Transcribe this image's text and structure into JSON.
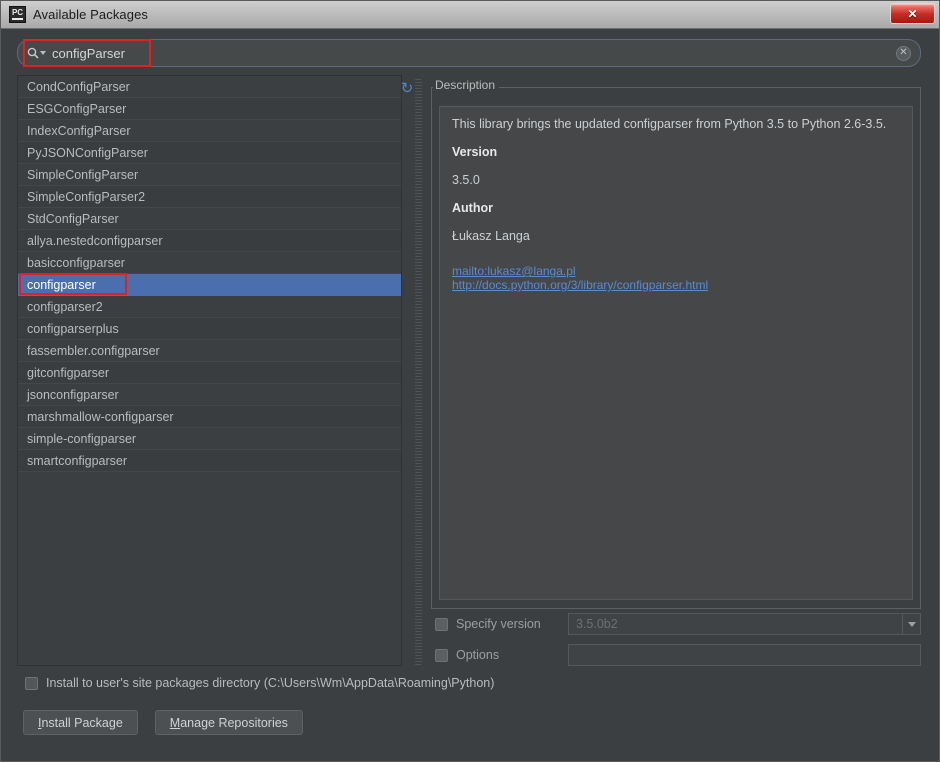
{
  "window": {
    "title": "Available Packages",
    "app_icon": "pycharm-icon",
    "close_label": "✕"
  },
  "search": {
    "value": "configParser",
    "placeholder": "",
    "icon": "search-icon",
    "chevron": "chevron-down-icon",
    "clear_icon": "✕"
  },
  "packages": {
    "refresh_icon": "↻",
    "items": [
      "CondConfigParser",
      "ESGConfigParser",
      "IndexConfigParser",
      "PyJSONConfigParser",
      "SimpleConfigParser",
      "SimpleConfigParser2",
      "StdConfigParser",
      "allya.nestedconfigparser",
      "basicconfigparser",
      "configparser",
      "configparser2",
      "configparserplus",
      "fassembler.configparser",
      "gitconfigparser",
      "jsonconfigparser",
      "marshmallow-configparser",
      "simple-configparser",
      "smartconfigparser"
    ],
    "selected": "configparser"
  },
  "description": {
    "legend": "Description",
    "summary": "This library brings the updated configparser from Python 3.5 to Python 2.6-3.5.",
    "version_heading": "Version",
    "version_value": "3.5.0",
    "author_heading": "Author",
    "author_value": "Łukasz Langa",
    "links": [
      "mailto:lukasz@langa.pl",
      "http://docs.python.org/3/library/configparser.html"
    ]
  },
  "options": {
    "specify_version_label": "Specify version",
    "specify_version_value": "3.5.0b2",
    "options_label": "Options",
    "options_value": "",
    "install_user_label": "Install to user's site packages directory (C:\\Users\\Wm\\AppData\\Roaming\\Python)"
  },
  "buttons": {
    "install_mnemonic": "I",
    "install_rest": "nstall Package",
    "manage_mnemonic": "M",
    "manage_rest": "anage Repositories"
  },
  "colors": {
    "selection_blue": "#4b6eaf",
    "annotation_red": "#e41f1f",
    "link_blue": "#5b8bd0",
    "panel_bg": "#3c3f41"
  }
}
